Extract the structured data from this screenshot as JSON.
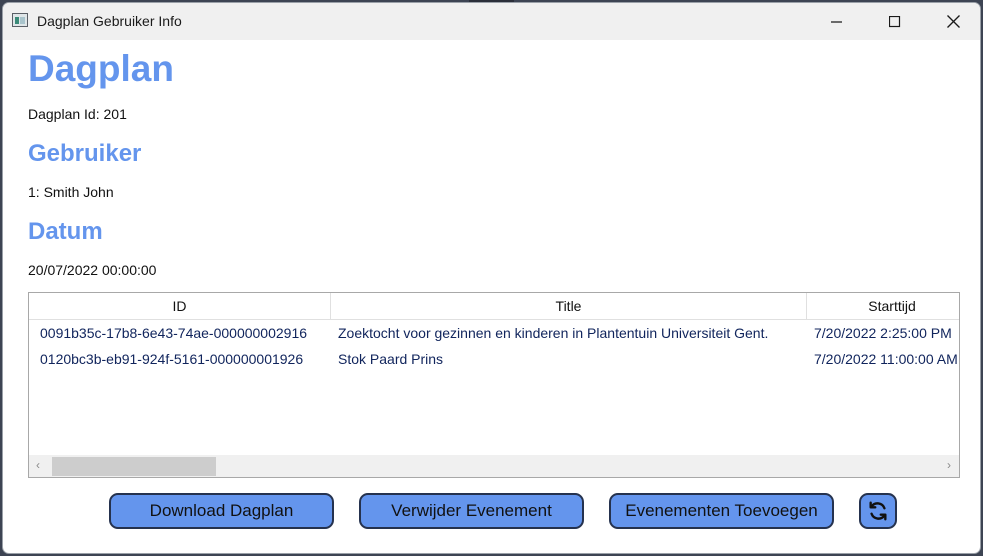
{
  "window": {
    "title": "Dagplan Gebruiker Info",
    "controls": {
      "minimize": "minimize-icon",
      "maximize": "maximize-icon",
      "close": "close-icon"
    }
  },
  "header": {
    "title": "Dagplan",
    "dagplan_id_text": "Dagplan Id: 201"
  },
  "gebruiker": {
    "heading": "Gebruiker",
    "value": "1: Smith John"
  },
  "datum": {
    "heading": "Datum",
    "value": "20/07/2022 00:00:00"
  },
  "table": {
    "columns": [
      "ID",
      "Title",
      "Starttijd"
    ],
    "rows": [
      [
        "0091b35c-17b8-6e43-74ae-000000002916",
        "Zoektocht voor gezinnen en kinderen in Plantentuin Universiteit Gent.",
        "7/20/2022 2:25:00 PM"
      ],
      [
        "0120bc3b-eb91-924f-5161-000000001926",
        "Stok Paard Prins",
        "7/20/2022 11:00:00 AM"
      ]
    ]
  },
  "buttons": {
    "download": "Download Dagplan",
    "verwijder": "Verwijder Evenement",
    "toevoegen": "Evenementen Toevoegen",
    "refresh_icon": "refresh-icon"
  },
  "colors": {
    "accent": "#6495ed",
    "button_border": "#25324e",
    "cell_text": "#10245c"
  }
}
